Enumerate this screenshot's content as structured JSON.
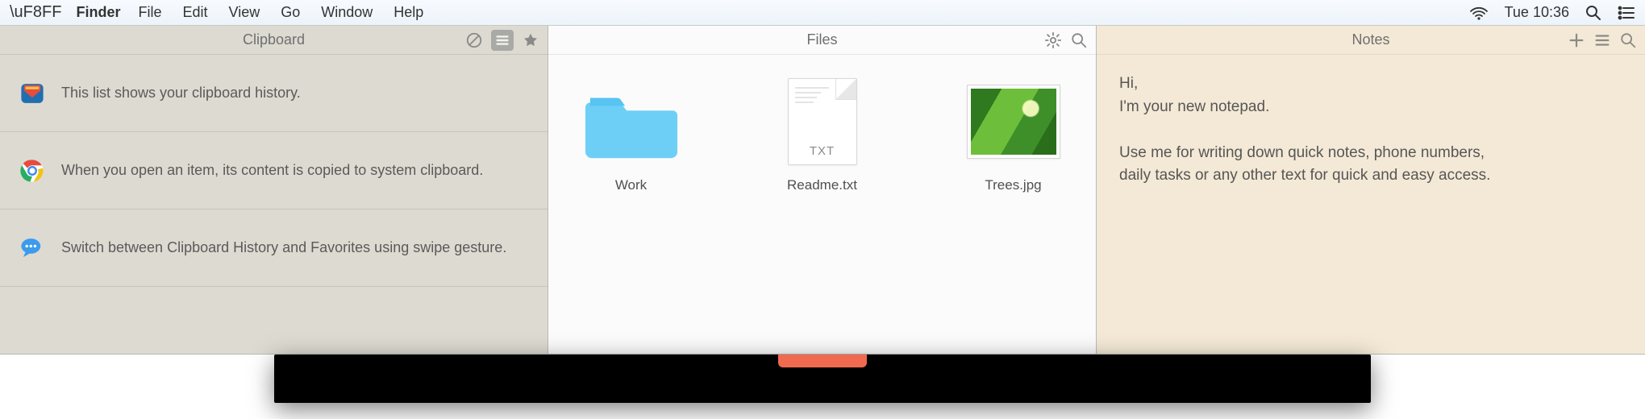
{
  "menubar": {
    "app": "Finder",
    "items": [
      "File",
      "Edit",
      "View",
      "Go",
      "Window",
      "Help"
    ],
    "clock": "Tue 10:36"
  },
  "clipboard": {
    "title": "Clipboard",
    "items": [
      {
        "icon": "pocket",
        "text": "This list shows your clipboard history."
      },
      {
        "icon": "chrome",
        "text": "When you open an item, its content\nis copied to system clipboard."
      },
      {
        "icon": "messages",
        "text": "Switch between Clipboard History and\nFavorites using swipe gesture."
      }
    ]
  },
  "files": {
    "title": "Files",
    "items": [
      {
        "type": "folder",
        "label": "Work"
      },
      {
        "type": "txt",
        "label": "Readme.txt",
        "badge": "TXT"
      },
      {
        "type": "image",
        "label": "Trees.jpg"
      }
    ]
  },
  "notes": {
    "title": "Notes",
    "body": "Hi,\nI'm your new notepad.\n\nUse me for writing down quick notes, phone numbers,\ndaily tasks or any other text for quick and easy access."
  }
}
